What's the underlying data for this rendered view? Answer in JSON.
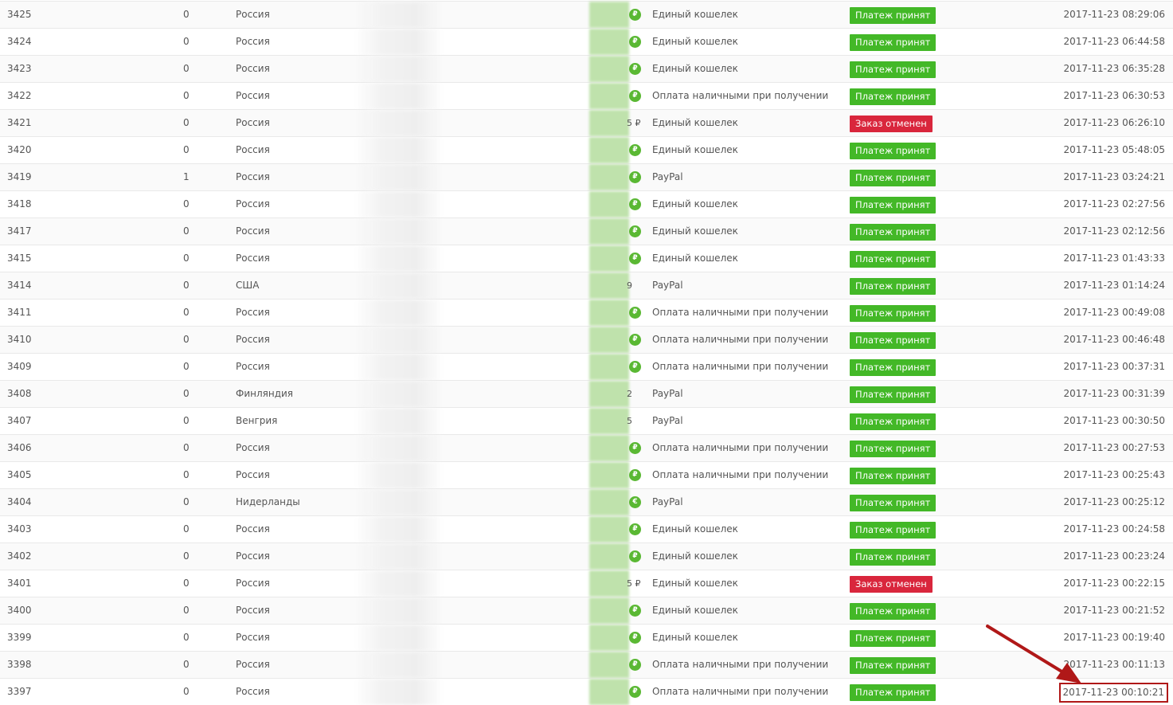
{
  "rows": [
    {
      "id": "3425",
      "qty": "0",
      "country": "Россия",
      "currency": "₽",
      "payment": "Единый кошелек",
      "status": "Платеж принят",
      "status_type": "ok",
      "date": "2017-11-23 08:29:06"
    },
    {
      "id": "3424",
      "qty": "0",
      "country": "Россия",
      "currency": "₽",
      "payment": "Единый кошелек",
      "status": "Платеж принят",
      "status_type": "ok",
      "date": "2017-11-23 06:44:58"
    },
    {
      "id": "3423",
      "qty": "0",
      "country": "Россия",
      "currency": "₽",
      "payment": "Единый кошелек",
      "status": "Платеж принят",
      "status_type": "ok",
      "date": "2017-11-23 06:35:28"
    },
    {
      "id": "3422",
      "qty": "0",
      "country": "Россия",
      "currency": "₽",
      "payment": "Оплата наличными при получении",
      "status": "Платеж принят",
      "status_type": "ok",
      "date": "2017-11-23 06:30:53"
    },
    {
      "id": "3421",
      "qty": "0",
      "country": "Россия",
      "currency": "5 ₽",
      "payment": "Единый кошелек",
      "status": "Заказ отменен",
      "status_type": "cancel",
      "date": "2017-11-23 06:26:10"
    },
    {
      "id": "3420",
      "qty": "0",
      "country": "Россия",
      "currency": "₽",
      "payment": "Единый кошелек",
      "status": "Платеж принят",
      "status_type": "ok",
      "date": "2017-11-23 05:48:05"
    },
    {
      "id": "3419",
      "qty": "1",
      "country": "Россия",
      "currency": "₽",
      "payment": "PayPal",
      "status": "Платеж принят",
      "status_type": "ok",
      "date": "2017-11-23 03:24:21"
    },
    {
      "id": "3418",
      "qty": "0",
      "country": "Россия",
      "currency": "₽",
      "payment": "Единый кошелек",
      "status": "Платеж принят",
      "status_type": "ok",
      "date": "2017-11-23 02:27:56"
    },
    {
      "id": "3417",
      "qty": "0",
      "country": "Россия",
      "currency": "₽",
      "payment": "Единый кошелек",
      "status": "Платеж принят",
      "status_type": "ok",
      "date": "2017-11-23 02:12:56"
    },
    {
      "id": "3415",
      "qty": "0",
      "country": "Россия",
      "currency": "₽",
      "payment": "Единый кошелек",
      "status": "Платеж принят",
      "status_type": "ok",
      "date": "2017-11-23 01:43:33"
    },
    {
      "id": "3414",
      "qty": "0",
      "country": "США",
      "currency": "9",
      "payment": "PayPal",
      "status": "Платеж принят",
      "status_type": "ok",
      "date": "2017-11-23 01:14:24"
    },
    {
      "id": "3411",
      "qty": "0",
      "country": "Россия",
      "currency": "₽",
      "payment": "Оплата наличными при получении",
      "status": "Платеж принят",
      "status_type": "ok",
      "date": "2017-11-23 00:49:08"
    },
    {
      "id": "3410",
      "qty": "0",
      "country": "Россия",
      "currency": "₽",
      "payment": "Оплата наличными при получении",
      "status": "Платеж принят",
      "status_type": "ok",
      "date": "2017-11-23 00:46:48"
    },
    {
      "id": "3409",
      "qty": "0",
      "country": "Россия",
      "currency": "₽",
      "payment": "Оплата наличными при получении",
      "status": "Платеж принят",
      "status_type": "ok",
      "date": "2017-11-23 00:37:31"
    },
    {
      "id": "3408",
      "qty": "0",
      "country": "Финляндия",
      "currency": "2",
      "payment": "PayPal",
      "status": "Платеж принят",
      "status_type": "ok",
      "date": "2017-11-23 00:31:39"
    },
    {
      "id": "3407",
      "qty": "0",
      "country": "Венгрия",
      "currency": "5",
      "payment": "PayPal",
      "status": "Платеж принят",
      "status_type": "ok",
      "date": "2017-11-23 00:30:50"
    },
    {
      "id": "3406",
      "qty": "0",
      "country": "Россия",
      "currency": "₽",
      "payment": "Оплата наличными при получении",
      "status": "Платеж принят",
      "status_type": "ok",
      "date": "2017-11-23 00:27:53"
    },
    {
      "id": "3405",
      "qty": "0",
      "country": "Россия",
      "currency": "₽",
      "payment": "Оплата наличными при получении",
      "status": "Платеж принят",
      "status_type": "ok",
      "date": "2017-11-23 00:25:43"
    },
    {
      "id": "3404",
      "qty": "0",
      "country": "Нидерланды",
      "currency": "€",
      "payment": "PayPal",
      "status": "Платеж принят",
      "status_type": "ok",
      "date": "2017-11-23 00:25:12"
    },
    {
      "id": "3403",
      "qty": "0",
      "country": "Россия",
      "currency": "₽",
      "payment": "Единый кошелек",
      "status": "Платеж принят",
      "status_type": "ok",
      "date": "2017-11-23 00:24:58"
    },
    {
      "id": "3402",
      "qty": "0",
      "country": "Россия",
      "currency": "₽",
      "payment": "Единый кошелек",
      "status": "Платеж принят",
      "status_type": "ok",
      "date": "2017-11-23 00:23:24"
    },
    {
      "id": "3401",
      "qty": "0",
      "country": "Россия",
      "currency": "5 ₽",
      "payment": "Единый кошелек",
      "status": "Заказ отменен",
      "status_type": "cancel",
      "date": "2017-11-23 00:22:15"
    },
    {
      "id": "3400",
      "qty": "0",
      "country": "Россия",
      "currency": "₽",
      "payment": "Единый кошелек",
      "status": "Платеж принят",
      "status_type": "ok",
      "date": "2017-11-23 00:21:52"
    },
    {
      "id": "3399",
      "qty": "0",
      "country": "Россия",
      "currency": "₽",
      "payment": "Единый кошелек",
      "status": "Платеж принят",
      "status_type": "ok",
      "date": "2017-11-23 00:19:40"
    },
    {
      "id": "3398",
      "qty": "0",
      "country": "Россия",
      "currency": "₽",
      "payment": "Оплата наличными при получении",
      "status": "Платеж принят",
      "status_type": "ok",
      "date": "2017-11-23 00:11:13"
    },
    {
      "id": "3397",
      "qty": "0",
      "country": "Россия",
      "currency": "₽",
      "payment": "Оплата наличными при получении",
      "status": "Платеж принят",
      "status_type": "ok",
      "date": "2017-11-23 00:10:21",
      "highlighted": true
    }
  ],
  "colors": {
    "status_ok": "#43b827",
    "status_cancel": "#d9263c",
    "currency_badge": "#5ab833",
    "annotation": "#b01818"
  }
}
